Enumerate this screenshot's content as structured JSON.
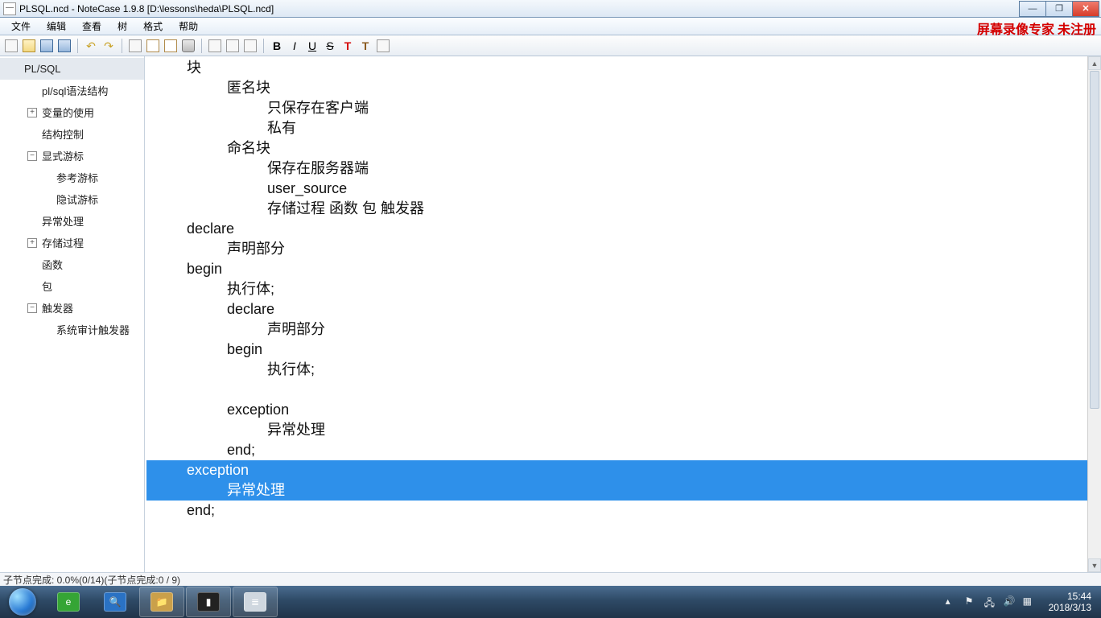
{
  "window": {
    "title": "PLSQL.ncd - NoteCase 1.9.8 [D:\\lessons\\heda\\PLSQL.ncd]"
  },
  "menu": {
    "items": [
      "文件",
      "编辑",
      "查看",
      "树",
      "格式",
      "帮助"
    ],
    "watermark": "屏幕录像专家  未注册"
  },
  "toolbar": {
    "groups": [
      {
        "items": [
          {
            "name": "new-file-icon",
            "kind": "generic"
          },
          {
            "name": "open-folder-icon",
            "kind": "folder"
          },
          {
            "name": "save-icon",
            "kind": "disk"
          },
          {
            "name": "save-as-icon",
            "kind": "disk2"
          }
        ]
      },
      {
        "items": [
          {
            "name": "undo-icon",
            "glyph": "↶",
            "color": "#c9a227"
          },
          {
            "name": "redo-icon",
            "glyph": "↷",
            "color": "#c9a227"
          }
        ]
      },
      {
        "items": [
          {
            "name": "cut-icon",
            "kind": "generic"
          },
          {
            "name": "copy-icon",
            "kind": "clip"
          },
          {
            "name": "paste-icon",
            "kind": "clip"
          },
          {
            "name": "delete-icon",
            "kind": "bin"
          }
        ]
      },
      {
        "items": [
          {
            "name": "link-icon",
            "kind": "generic"
          },
          {
            "name": "image-icon",
            "kind": "generic"
          },
          {
            "name": "attach-icon",
            "kind": "generic"
          }
        ]
      },
      {
        "items": [
          {
            "name": "bold-icon",
            "glyph": "B",
            "cls": "b"
          },
          {
            "name": "italic-icon",
            "glyph": "I",
            "cls": "i"
          },
          {
            "name": "underline-icon",
            "glyph": "U",
            "cls": "u"
          },
          {
            "name": "strike-icon",
            "glyph": "S",
            "cls": "s"
          },
          {
            "name": "text-color-icon",
            "glyph": "T",
            "cls": "tred"
          },
          {
            "name": "text-bg-icon",
            "glyph": "T",
            "cls": "tbrown"
          },
          {
            "name": "options-icon",
            "kind": "generic"
          }
        ]
      }
    ]
  },
  "tree": {
    "items": [
      {
        "depth": 0,
        "expander": "none",
        "label": "PL/SQL",
        "selected": true
      },
      {
        "depth": 1,
        "expander": "none",
        "label": "pl/sql语法结构"
      },
      {
        "depth": 1,
        "expander": "plus",
        "label": "变量的使用"
      },
      {
        "depth": 1,
        "expander": "none",
        "label": "结构控制"
      },
      {
        "depth": 1,
        "expander": "minus",
        "label": "显式游标"
      },
      {
        "depth": 2,
        "expander": "none",
        "label": "参考游标"
      },
      {
        "depth": 2,
        "expander": "none",
        "label": "隐试游标"
      },
      {
        "depth": 1,
        "expander": "none",
        "label": "异常处理"
      },
      {
        "depth": 1,
        "expander": "plus",
        "label": "存储过程"
      },
      {
        "depth": 1,
        "expander": "none",
        "label": "函数"
      },
      {
        "depth": 1,
        "expander": "none",
        "label": "包"
      },
      {
        "depth": 1,
        "expander": "minus",
        "label": "触发器"
      },
      {
        "depth": 2,
        "expander": "none",
        "label": "系统审计触发器"
      }
    ]
  },
  "editor": {
    "lines": [
      {
        "indent": 1,
        "text": "块"
      },
      {
        "indent": 2,
        "text": "匿名块"
      },
      {
        "indent": 3,
        "text": "只保存在客户端"
      },
      {
        "indent": 3,
        "text": "私有"
      },
      {
        "indent": 2,
        "text": "命名块"
      },
      {
        "indent": 3,
        "text": "保存在服务器端"
      },
      {
        "indent": 3,
        "text": "user_source"
      },
      {
        "indent": 3,
        "text": "存储过程 函数 包 触发器"
      },
      {
        "indent": 1,
        "text": "declare"
      },
      {
        "indent": 2,
        "text": "声明部分"
      },
      {
        "indent": 1,
        "text": "begin"
      },
      {
        "indent": 2,
        "text": "执行体;"
      },
      {
        "indent": 2,
        "text": "declare"
      },
      {
        "indent": 3,
        "text": "声明部分"
      },
      {
        "indent": 2,
        "text": "begin"
      },
      {
        "indent": 3,
        "text": "执行体;"
      },
      {
        "indent": 2,
        "text": ""
      },
      {
        "indent": 2,
        "text": "exception"
      },
      {
        "indent": 3,
        "text": "异常处理"
      },
      {
        "indent": 2,
        "text": "end;"
      },
      {
        "indent": 1,
        "text": "exception",
        "selected": true,
        "selStart": true
      },
      {
        "indent": 2,
        "text": "异常处理",
        "selected": true
      },
      {
        "indent": 1,
        "text": "end;"
      }
    ],
    "indentUnit": "          "
  },
  "status": {
    "text": "子节点完成:  0.0%(0/14)(子节点完成:0 / 9)"
  },
  "taskbar": {
    "apps": [
      {
        "name": "start-button",
        "glyph": ""
      },
      {
        "name": "ie-icon",
        "glyph": "e",
        "bg": "#35a535"
      },
      {
        "name": "magnifier-icon",
        "glyph": "🔍",
        "bg": "#2a72c4"
      },
      {
        "name": "explorer-icon",
        "glyph": "📁",
        "bg": "#caa04a",
        "active": true
      },
      {
        "name": "cmd-icon",
        "glyph": "▮",
        "bg": "#222",
        "active": true
      },
      {
        "name": "notecase-icon",
        "glyph": "≣",
        "bg": "#cfd7df",
        "active": true
      }
    ],
    "tray": [
      {
        "name": "tray-chevron-icon",
        "glyph": "▴"
      },
      {
        "name": "flag-icon",
        "glyph": "⚑"
      },
      {
        "name": "network-icon",
        "glyph": "🖧"
      },
      {
        "name": "volume-icon",
        "glyph": "🔊"
      },
      {
        "name": "ime-icon",
        "glyph": "▦"
      }
    ],
    "time": "15:44",
    "date": "2018/3/13"
  }
}
